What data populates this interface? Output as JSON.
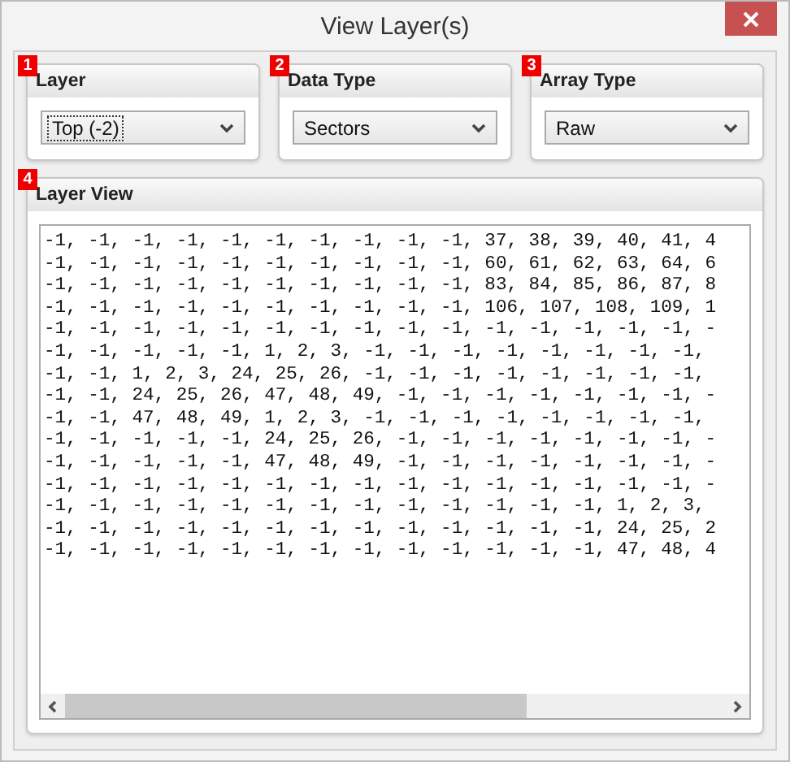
{
  "window": {
    "title": "View Layer(s)"
  },
  "groups": [
    {
      "badge": "1",
      "title": "Layer",
      "dropdown": {
        "value": "Top (-2)",
        "focused": true
      }
    },
    {
      "badge": "2",
      "title": "Data Type",
      "dropdown": {
        "value": "Sectors",
        "focused": false
      }
    },
    {
      "badge": "3",
      "title": "Array Type",
      "dropdown": {
        "value": "Raw",
        "focused": false
      }
    }
  ],
  "layer_view": {
    "badge": "4",
    "title": "Layer View",
    "lines": [
      "-1, -1, -1, -1, -1, -1, -1, -1, -1, -1, 37, 38, 39, 40, 41, 4",
      "-1, -1, -1, -1, -1, -1, -1, -1, -1, -1, 60, 61, 62, 63, 64, 6",
      "-1, -1, -1, -1, -1, -1, -1, -1, -1, -1, 83, 84, 85, 86, 87, 8",
      "-1, -1, -1, -1, -1, -1, -1, -1, -1, -1, 106, 107, 108, 109, 1",
      "-1, -1, -1, -1, -1, -1, -1, -1, -1, -1, -1, -1, -1, -1, -1, -",
      "-1, -1, -1, -1, -1, 1, 2, 3, -1, -1, -1, -1, -1, -1, -1, -1,",
      "-1, -1, 1, 2, 3, 24, 25, 26, -1, -1, -1, -1, -1, -1, -1, -1,",
      "-1, -1, 24, 25, 26, 47, 48, 49, -1, -1, -1, -1, -1, -1, -1, -",
      "-1, -1, 47, 48, 49, 1, 2, 3, -1, -1, -1, -1, -1, -1, -1, -1,",
      "-1, -1, -1, -1, -1, 24, 25, 26, -1, -1, -1, -1, -1, -1, -1, -",
      "-1, -1, -1, -1, -1, 47, 48, 49, -1, -1, -1, -1, -1, -1, -1, -",
      "-1, -1, -1, -1, -1, -1, -1, -1, -1, -1, -1, -1, -1, -1, -1, -",
      "-1, -1, -1, -1, -1, -1, -1, -1, -1, -1, -1, -1, -1, 1, 2, 3,",
      "-1, -1, -1, -1, -1, -1, -1, -1, -1, -1, -1, -1, -1, 24, 25, 2",
      "-1, -1, -1, -1, -1, -1, -1, -1, -1, -1, -1, -1, -1, 47, 48, 4"
    ]
  }
}
